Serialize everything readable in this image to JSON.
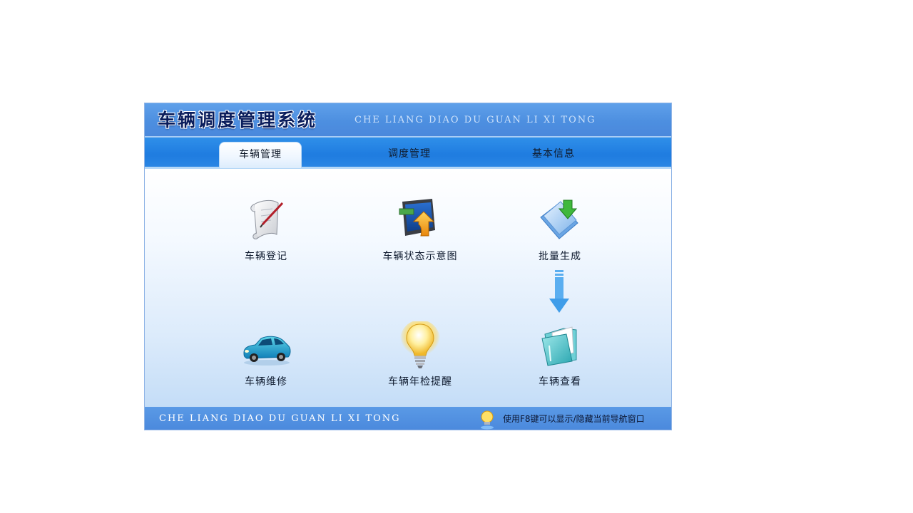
{
  "header": {
    "title": "车辆调度管理系统",
    "subtitle": "CHE LIANG DIAO DU GUAN LI XI TONG"
  },
  "tabs": [
    {
      "label": "车辆管理",
      "active": true
    },
    {
      "label": "调度管理",
      "active": false
    },
    {
      "label": "基本信息",
      "active": false
    }
  ],
  "nav_items": [
    {
      "label": "车辆登记",
      "icon": "scroll-pen-icon"
    },
    {
      "label": "车辆状态示意图",
      "icon": "monitor-arrow-icon"
    },
    {
      "label": "批量生成",
      "icon": "documents-download-icon"
    },
    {
      "label": "车辆维修",
      "icon": "car-icon"
    },
    {
      "label": "车辆年检提醒",
      "icon": "lightbulb-icon"
    },
    {
      "label": "车辆查看",
      "icon": "folder-icon"
    }
  ],
  "footer": {
    "text": "CHE LIANG DIAO DU GUAN LI XI TONG",
    "hint": "使用F8键可以显示/隐藏当前导航窗口"
  },
  "colors": {
    "header_blue": "#4d8fe0",
    "tab_bar_blue": "#1f7ce0",
    "title_navy": "#0a1d5c",
    "arrow_blue": "#4aa3ef"
  }
}
